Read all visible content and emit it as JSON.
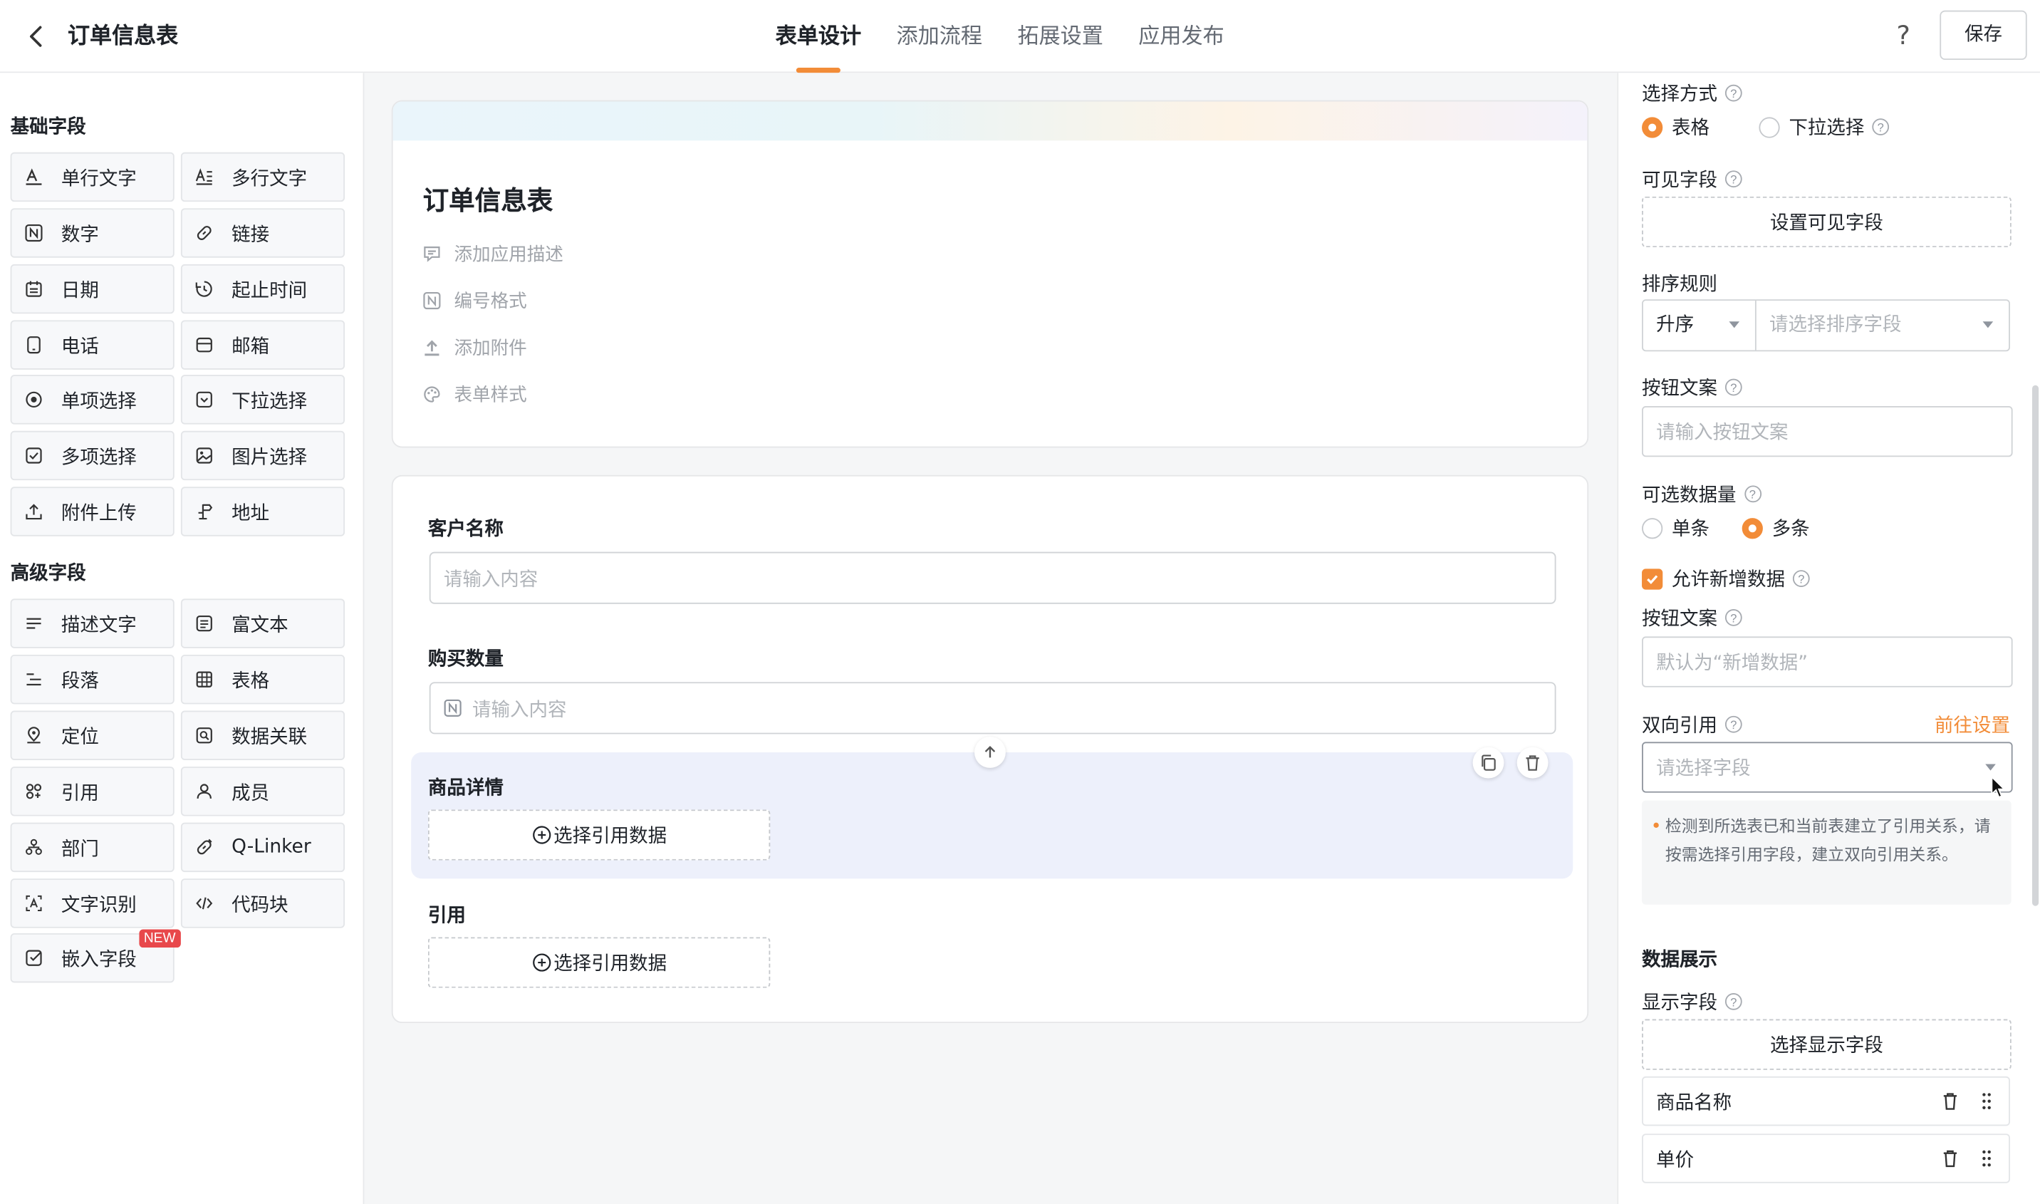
{
  "header": {
    "title": "订单信息表",
    "tabs": [
      {
        "label": "表单设计",
        "active": true
      },
      {
        "label": "添加流程",
        "active": false
      },
      {
        "label": "拓展设置",
        "active": false
      },
      {
        "label": "应用发布",
        "active": false
      }
    ],
    "help": "?",
    "save_label": "保存",
    "accent_color": "#f28c38"
  },
  "left_panel": {
    "basic_title": "基础字段",
    "basic_fields": [
      {
        "label": "单行文字",
        "icon": "single-text-icon"
      },
      {
        "label": "多行文字",
        "icon": "multi-text-icon"
      },
      {
        "label": "数字",
        "icon": "number-icon"
      },
      {
        "label": "链接",
        "icon": "link-icon"
      },
      {
        "label": "日期",
        "icon": "calendar-icon"
      },
      {
        "label": "起止时间",
        "icon": "time-range-icon"
      },
      {
        "label": "电话",
        "icon": "phone-icon"
      },
      {
        "label": "邮箱",
        "icon": "mail-icon"
      },
      {
        "label": "单项选择",
        "icon": "radio-icon"
      },
      {
        "label": "下拉选择",
        "icon": "dropdown-icon"
      },
      {
        "label": "多项选择",
        "icon": "checkbox-icon"
      },
      {
        "label": "图片选择",
        "icon": "image-icon"
      },
      {
        "label": "附件上传",
        "icon": "upload-icon"
      },
      {
        "label": "地址",
        "icon": "address-icon"
      }
    ],
    "advanced_title": "高级字段",
    "advanced_fields": [
      {
        "label": "描述文字",
        "icon": "description-icon"
      },
      {
        "label": "富文本",
        "icon": "rich-text-icon"
      },
      {
        "label": "段落",
        "icon": "paragraph-icon"
      },
      {
        "label": "表格",
        "icon": "table-icon"
      },
      {
        "label": "定位",
        "icon": "location-icon"
      },
      {
        "label": "数据关联",
        "icon": "data-link-icon"
      },
      {
        "label": "引用",
        "icon": "reference-icon"
      },
      {
        "label": "成员",
        "icon": "member-icon"
      },
      {
        "label": "部门",
        "icon": "department-icon"
      },
      {
        "label": "Q-Linker",
        "icon": "q-linker-icon"
      },
      {
        "label": "文字识别",
        "icon": "ocr-icon"
      },
      {
        "label": "代码块",
        "icon": "code-icon"
      },
      {
        "label": "嵌入字段",
        "icon": "embed-icon",
        "badge": "NEW"
      }
    ]
  },
  "center": {
    "form_title": "订单信息表",
    "meta_items": [
      {
        "label": "添加应用描述",
        "icon": "comment-icon"
      },
      {
        "label": "编号格式",
        "icon": "number-format-icon"
      },
      {
        "label": "添加附件",
        "icon": "attach-icon"
      },
      {
        "label": "表单样式",
        "icon": "palette-icon"
      }
    ],
    "fields": {
      "customer": {
        "label": "客户名称",
        "placeholder": "请输入内容"
      },
      "quantity": {
        "label": "购买数量",
        "placeholder": "请输入内容"
      },
      "product_detail": {
        "label": "商品详情",
        "button": "选择引用数据"
      },
      "reference": {
        "label": "引用",
        "button": "选择引用数据"
      }
    }
  },
  "right_panel": {
    "select_mode": {
      "label": "选择方式",
      "options": [
        "表格",
        "下拉选择"
      ],
      "selected": "表格"
    },
    "visible_fields": {
      "label": "可见字段",
      "button": "设置可见字段"
    },
    "sort_rule": {
      "label": "排序规则",
      "order": "升序",
      "field_placeholder": "请选择排序字段"
    },
    "button_text": {
      "label": "按钮文案",
      "placeholder": "请输入按钮文案"
    },
    "selectable_count": {
      "label": "可选数据量",
      "options": [
        "单条",
        "多条"
      ],
      "selected": "多条"
    },
    "allow_add": {
      "label": "允许新增数据",
      "checked": true
    },
    "add_button_text": {
      "label": "按钮文案",
      "placeholder": "默认为“新增数据”"
    },
    "bidirectional": {
      "label": "双向引用",
      "link": "前往设置",
      "placeholder": "请选择字段"
    },
    "notice": "检测到所选表已和当前表建立了引用关系，请按需选择引用字段，建立双向引用关系。",
    "data_display": {
      "title": "数据展示",
      "show_fields_label": "显示字段",
      "button": "选择显示字段",
      "items": [
        "商品名称",
        "单价"
      ]
    }
  }
}
